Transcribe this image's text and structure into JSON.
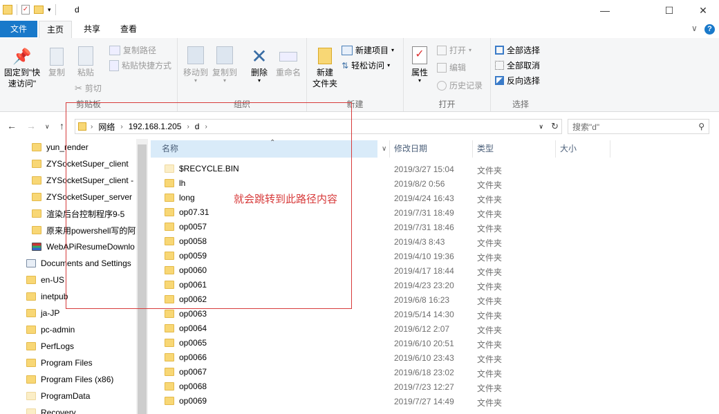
{
  "window": {
    "title": "d",
    "minimize": "—",
    "maximize": "☐",
    "close": "✕"
  },
  "tabs": {
    "file": "文件",
    "home": "主页",
    "share": "共享",
    "view": "查看",
    "expand": "∨",
    "help": "?"
  },
  "ribbon": {
    "clipboard": {
      "label": "剪贴板",
      "pin": "固定到\"快速访问\"",
      "copy": "复制",
      "paste": "粘贴",
      "copy_path": "复制路径",
      "paste_shortcut": "粘贴快捷方式",
      "cut": "剪切"
    },
    "organize": {
      "label": "组织",
      "move_to": "移动到",
      "copy_to": "复制到",
      "delete": "删除",
      "rename": "重命名"
    },
    "new": {
      "label": "新建",
      "new_folder": "新建\n文件夹",
      "new_item": "新建项目",
      "easy_access": "轻松访问"
    },
    "open": {
      "label": "打开",
      "properties": "属性",
      "open": "打开",
      "edit": "编辑",
      "history": "历史记录"
    },
    "select": {
      "label": "选择",
      "select_all": "全部选择",
      "select_none": "全部取消",
      "invert": "反向选择"
    }
  },
  "address": {
    "crumbs": [
      "网络",
      "192.168.1.205",
      "d"
    ],
    "search_placeholder": "搜索\"d\""
  },
  "nav_pane": [
    {
      "label": "yun_render",
      "icon": "folder-icon"
    },
    {
      "label": "ZYSocketSuper_client",
      "icon": "folder-icon"
    },
    {
      "label": "ZYSocketSuper_client -",
      "icon": "folder-icon"
    },
    {
      "label": "ZYSocketSuper_server",
      "icon": "folder-icon"
    },
    {
      "label": "渲染后台控制程序9-5",
      "icon": "folder-icon"
    },
    {
      "label": "原来用powershell写的阿",
      "icon": "folder-icon"
    },
    {
      "label": "WebAPiResumeDownlo",
      "icon": "archive-icon"
    },
    {
      "label": "Documents and Settings",
      "icon": "shortcut-icon"
    },
    {
      "label": "en-US",
      "icon": "folder-icon"
    },
    {
      "label": "inetpub",
      "icon": "folder-icon"
    },
    {
      "label": "ja-JP",
      "icon": "folder-icon"
    },
    {
      "label": "pc-admin",
      "icon": "folder-icon"
    },
    {
      "label": "PerfLogs",
      "icon": "folder-icon"
    },
    {
      "label": "Program Files",
      "icon": "folder-icon"
    },
    {
      "label": "Program Files (x86)",
      "icon": "folder-icon"
    },
    {
      "label": "ProgramData",
      "icon": "folder-icon"
    },
    {
      "label": "Recovery",
      "icon": "folder-icon"
    }
  ],
  "columns": {
    "name": "名称",
    "date": "修改日期",
    "type": "类型",
    "size": "大小"
  },
  "files": [
    {
      "name": "$RECYCLE.BIN",
      "date": "2019/3/27 15:04",
      "type": "文件夹"
    },
    {
      "name": "lh",
      "date": "2019/8/2 0:56",
      "type": "文件夹"
    },
    {
      "name": "long",
      "date": "2019/4/24 16:43",
      "type": "文件夹"
    },
    {
      "name": "op07.31",
      "date": "2019/7/31 18:49",
      "type": "文件夹"
    },
    {
      "name": "op0057",
      "date": "2019/7/31 18:46",
      "type": "文件夹"
    },
    {
      "name": "op0058",
      "date": "2019/4/3 8:43",
      "type": "文件夹"
    },
    {
      "name": "op0059",
      "date": "2019/4/10 19:36",
      "type": "文件夹"
    },
    {
      "name": "op0060",
      "date": "2019/4/17 18:44",
      "type": "文件夹"
    },
    {
      "name": "op0061",
      "date": "2019/4/23 23:20",
      "type": "文件夹"
    },
    {
      "name": "op0062",
      "date": "2019/6/8 16:23",
      "type": "文件夹"
    },
    {
      "name": "op0063",
      "date": "2019/5/14 14:30",
      "type": "文件夹"
    },
    {
      "name": "op0064",
      "date": "2019/6/12 2:07",
      "type": "文件夹"
    },
    {
      "name": "op0065",
      "date": "2019/6/10 20:51",
      "type": "文件夹"
    },
    {
      "name": "op0066",
      "date": "2019/6/10 23:43",
      "type": "文件夹"
    },
    {
      "name": "op0067",
      "date": "2019/6/18 23:02",
      "type": "文件夹"
    },
    {
      "name": "op0068",
      "date": "2019/7/23 12:27",
      "type": "文件夹"
    },
    {
      "name": "op0069",
      "date": "2019/7/27 14:49",
      "type": "文件夹"
    }
  ],
  "annotation": "就会跳转到此路径内容",
  "colors": {
    "accent": "#1979ca",
    "annotation": "#d73a3a"
  }
}
